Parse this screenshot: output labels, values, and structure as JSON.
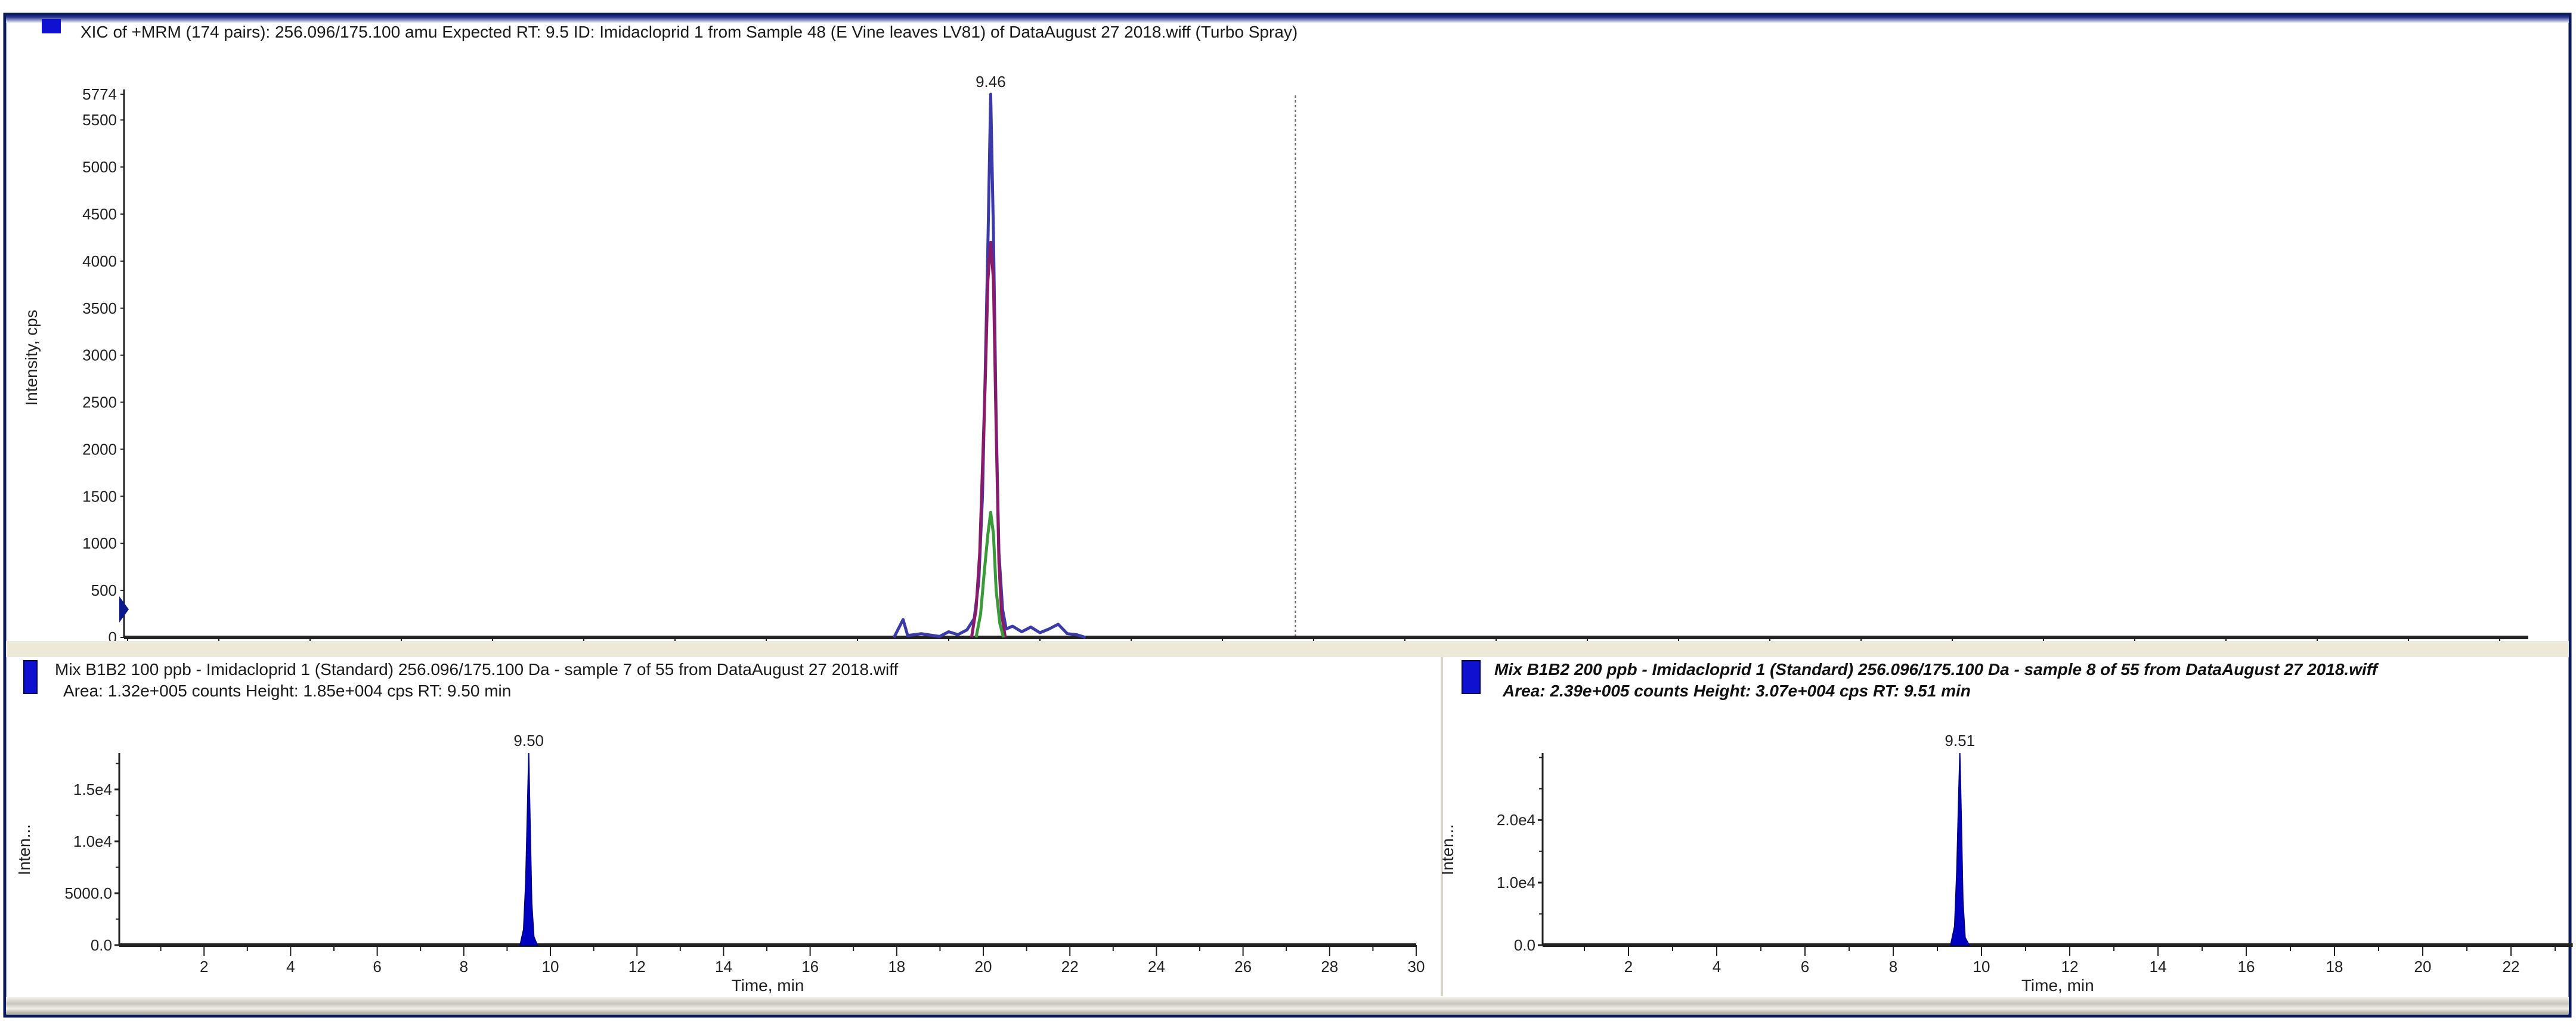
{
  "colors": {
    "frame": "#0a1a5c",
    "icon": "#1010d0",
    "band": "#ece9d8",
    "blue": "#3a3aa8",
    "magenta": "#8a1a6a",
    "green": "#3a9a3a",
    "fill": "#0000c0"
  },
  "chart_data": [
    {
      "type": "line",
      "title": "XIC of +MRM (174 pairs): 256.096/175.100 amu Expected RT: 9.5 ID: Imidacloprid 1 from Sample 48 (E Vine leaves LV81) of DataAugust 27 2018.wiff (Turbo Spray)",
      "ylabel": "Intensity, cps",
      "xlabel": "",
      "xlim": [
        0,
        26.3
      ],
      "ylim": [
        0,
        5774
      ],
      "yticks": [
        "0",
        "500",
        "1000",
        "1500",
        "2000",
        "2500",
        "3000",
        "3500",
        "4000",
        "4500",
        "5000",
        "5500",
        "5774"
      ],
      "ytick_values": [
        0,
        500,
        1000,
        1500,
        2000,
        2500,
        3000,
        3500,
        4000,
        4500,
        5000,
        5500,
        5774
      ],
      "peak_label": "9.46",
      "peak_rt": 9.46,
      "marker_line_x": 12.8,
      "series": [
        {
          "name": "blue",
          "points": [
            [
              8.4,
              0
            ],
            [
              8.5,
              190
            ],
            [
              8.55,
              20
            ],
            [
              8.7,
              40
            ],
            [
              8.9,
              10
            ],
            [
              9.0,
              60
            ],
            [
              9.1,
              30
            ],
            [
              9.2,
              80
            ],
            [
              9.28,
              200
            ],
            [
              9.33,
              600
            ],
            [
              9.37,
              1500
            ],
            [
              9.4,
              2800
            ],
            [
              9.43,
              4200
            ],
            [
              9.46,
              5774
            ],
            [
              9.49,
              4300
            ],
            [
              9.52,
              2300
            ],
            [
              9.55,
              900
            ],
            [
              9.59,
              300
            ],
            [
              9.63,
              90
            ],
            [
              9.7,
              120
            ],
            [
              9.8,
              60
            ],
            [
              9.9,
              110
            ],
            [
              10.0,
              50
            ],
            [
              10.1,
              90
            ],
            [
              10.2,
              140
            ],
            [
              10.3,
              40
            ],
            [
              10.4,
              30
            ],
            [
              10.5,
              0
            ]
          ]
        },
        {
          "name": "magenta",
          "points": [
            [
              9.25,
              0
            ],
            [
              9.3,
              300
            ],
            [
              9.34,
              900
            ],
            [
              9.37,
              1800
            ],
            [
              9.4,
              2700
            ],
            [
              9.43,
              3800
            ],
            [
              9.46,
              4200
            ],
            [
              9.49,
              3800
            ],
            [
              9.52,
              2200
            ],
            [
              9.55,
              800
            ],
            [
              9.58,
              250
            ],
            [
              9.62,
              0
            ]
          ]
        },
        {
          "name": "green",
          "points": [
            [
              9.3,
              0
            ],
            [
              9.35,
              250
            ],
            [
              9.39,
              700
            ],
            [
              9.43,
              1100
            ],
            [
              9.46,
              1330
            ],
            [
              9.49,
              1100
            ],
            [
              9.52,
              500
            ],
            [
              9.56,
              150
            ],
            [
              9.6,
              0
            ]
          ]
        }
      ]
    },
    {
      "type": "area",
      "title": "Mix B1B2 100 ppb - Imidacloprid 1 (Standard) 256.096/175.100 Da - sample 7 of 55 from DataAugust 27 2018.wiff",
      "subtitle": "Area: 1.32e+005 counts  Height: 1.85e+004 cps  RT: 9.50 min",
      "ylabel": "Inten...",
      "xlabel": "Time, min",
      "xlim": [
        0,
        30
      ],
      "ylim": [
        0,
        18500
      ],
      "xticks": [
        "2",
        "4",
        "6",
        "8",
        "10",
        "12",
        "14",
        "16",
        "18",
        "20",
        "22",
        "24",
        "26",
        "28",
        "30"
      ],
      "yticks": [
        "0.0",
        "5000.0",
        "1.0e4",
        "1.5e4"
      ],
      "ytick_values": [
        0,
        5000,
        10000,
        15000
      ],
      "peak_label": "9.50",
      "series": [
        {
          "name": "Imidacloprid 1",
          "points": [
            [
              9.3,
              0
            ],
            [
              9.38,
              1500
            ],
            [
              9.43,
              6000
            ],
            [
              9.47,
              13000
            ],
            [
              9.5,
              18500
            ],
            [
              9.53,
              12000
            ],
            [
              9.57,
              4000
            ],
            [
              9.62,
              800
            ],
            [
              9.7,
              0
            ]
          ]
        }
      ]
    },
    {
      "type": "area",
      "title": "Mix B1B2 200 ppb - Imidacloprid 1 (Standard) 256.096/175.100 Da - sample 8 of 55 from DataAugust 27 2018.wiff",
      "subtitle": "Area: 2.39e+005 counts  Height: 3.07e+004 cps  RT: 9.51 min",
      "ylabel": "Inten...",
      "xlabel": "Time, min",
      "xlim": [
        0,
        23.4
      ],
      "ylim": [
        0,
        30700
      ],
      "xticks": [
        "2",
        "4",
        "6",
        "8",
        "10",
        "12",
        "14",
        "16",
        "18",
        "20",
        "22"
      ],
      "yticks": [
        "0.0",
        "1.0e4",
        "2.0e4"
      ],
      "ytick_values": [
        0,
        10000,
        20000
      ],
      "peak_label": "9.51",
      "series": [
        {
          "name": "Imidacloprid 1",
          "points": [
            [
              9.3,
              0
            ],
            [
              9.39,
              3000
            ],
            [
              9.44,
              12000
            ],
            [
              9.48,
              23000
            ],
            [
              9.51,
              30700
            ],
            [
              9.54,
              21000
            ],
            [
              9.58,
              7000
            ],
            [
              9.63,
              1200
            ],
            [
              9.72,
              0
            ]
          ]
        }
      ]
    }
  ]
}
